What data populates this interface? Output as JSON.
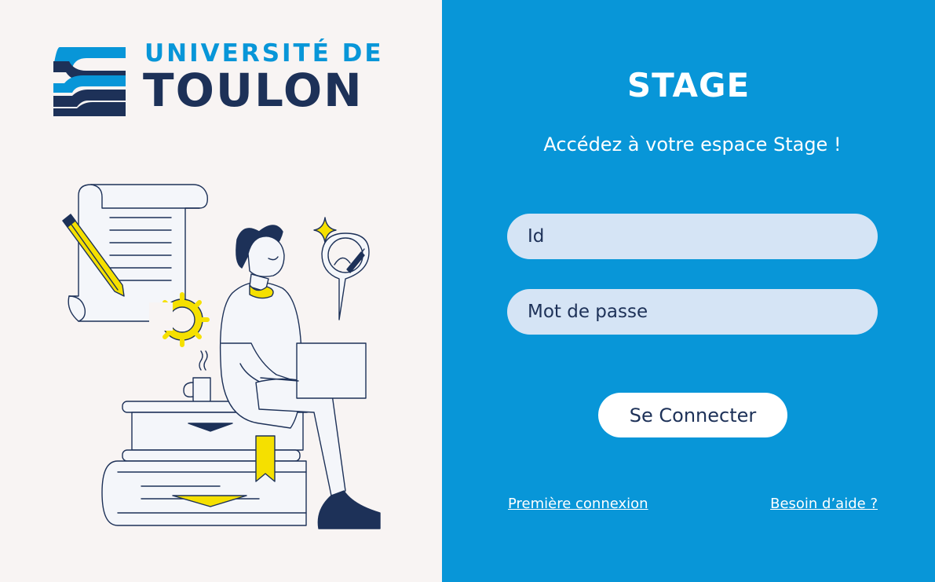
{
  "brand": {
    "line1": "UNIVERSITÉ DE",
    "line2": "TOULON",
    "color_light": "#0896d8",
    "color_dark": "#1d3158"
  },
  "login": {
    "title": "STAGE",
    "subtitle": "Accédez à votre espace Stage !",
    "id_placeholder": "Id",
    "password_placeholder": "Mot de passe",
    "submit_label": "Se Connecter",
    "first_login_link": "Première connexion",
    "help_link": "Besoin d’aide ?"
  },
  "colors": {
    "left_background": "#f8f4f3",
    "right_background": "#0896d8",
    "field_background": "#d5e4f5",
    "accent_yellow": "#f5e000"
  },
  "illustration": {
    "icons": [
      "scroll-document-icon",
      "pencil-icon",
      "gear-icon",
      "sparkle-icon",
      "chat-bubble-pen-icon",
      "coffee-mug-icon",
      "book-stack-icon",
      "laptop-icon"
    ]
  }
}
